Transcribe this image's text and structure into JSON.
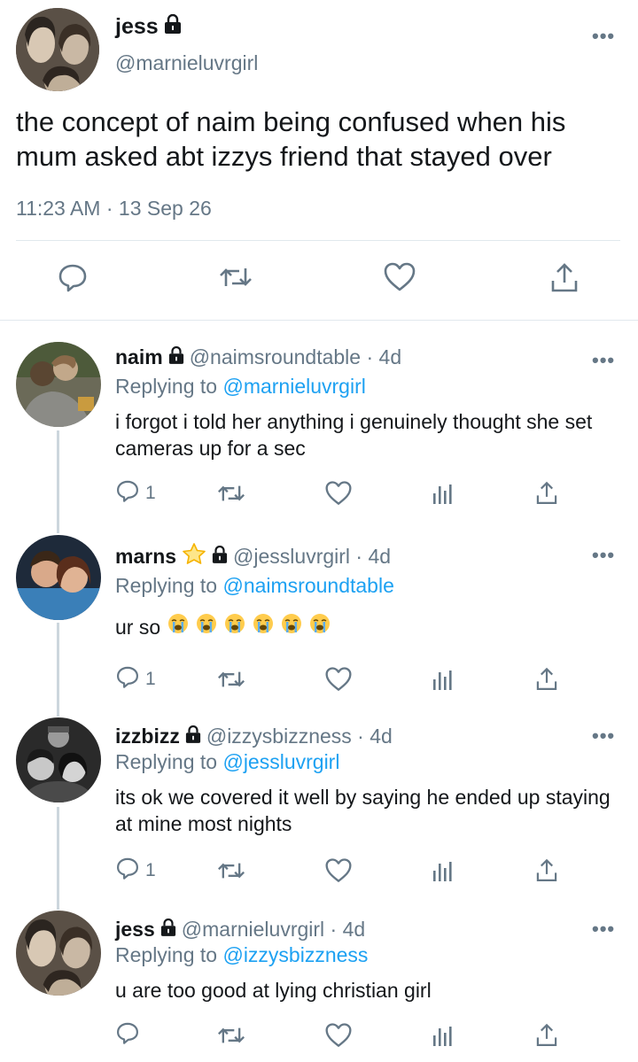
{
  "main": {
    "name": "jess",
    "handle": "@marnieluvrgirl",
    "text": "the concept of naim being confused when his mum asked abt izzys friend that stayed over",
    "time": "11:23 AM · 13 Sep 26",
    "more_icon": "more-dots-icon",
    "actions": [
      "reply-icon",
      "retweet-icon",
      "like-icon",
      "share-icon"
    ]
  },
  "replies": [
    {
      "name": "naim",
      "handle": "@naimsroundtable · 4d",
      "replying_label": "Replying to",
      "replying_to": "@marnieluvrgirl",
      "text": "i forgot i told her anything i genuinely thought she set cameras up for a sec",
      "reply_count": "1",
      "star": false
    },
    {
      "name": "marns",
      "handle": "@jessluvrgirl · 4d",
      "replying_label": "Replying to",
      "replying_to": "@naimsroundtable",
      "text": "ur so",
      "emoji_count": 6,
      "reply_count": "1",
      "star": true
    },
    {
      "name": "izzbizz",
      "handle": "@izzysbizzness · 4d",
      "replying_label": "Replying to",
      "replying_to": "@jessluvrgirl",
      "text": "its ok we covered it well by saying he ended up staying at mine most nights",
      "reply_count": "1",
      "star": false
    },
    {
      "name": "jess",
      "handle": "@marnieluvrgirl · 4d",
      "replying_label": "Replying to",
      "replying_to": "@izzysbizzness",
      "text": "u are too good at lying christian girl",
      "reply_count": "",
      "star": false
    }
  ],
  "colors": {
    "link": "#1da1f2",
    "muted": "#657786",
    "text": "#14171a",
    "divider": "#e1e8ed"
  }
}
